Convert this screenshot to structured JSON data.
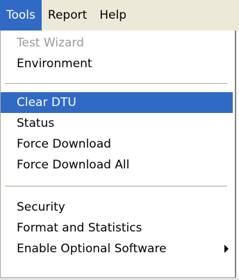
{
  "menubar": {
    "items": [
      {
        "label": "Tools"
      },
      {
        "label": "Report"
      },
      {
        "label": "Help"
      }
    ]
  },
  "tools_menu": {
    "items": [
      {
        "label": "Test Wizard",
        "enabled": false
      },
      {
        "label": "Environment",
        "enabled": true
      },
      {
        "label": "Clear DTU",
        "enabled": true,
        "highlighted": true
      },
      {
        "label": "Status",
        "enabled": true
      },
      {
        "label": "Force Download",
        "enabled": true
      },
      {
        "label": "Force Download All",
        "enabled": true
      },
      {
        "label": "Security",
        "enabled": true
      },
      {
        "label": "Format and Statistics",
        "enabled": true
      },
      {
        "label": "Enable Optional Software",
        "enabled": true,
        "has_submenu": true
      }
    ]
  },
  "colors": {
    "menubar_bg": "#ece9d8",
    "highlight": "#316ac5",
    "disabled_text": "#9a9a9a"
  },
  "icons": {
    "submenu": "triangle-right-icon"
  }
}
